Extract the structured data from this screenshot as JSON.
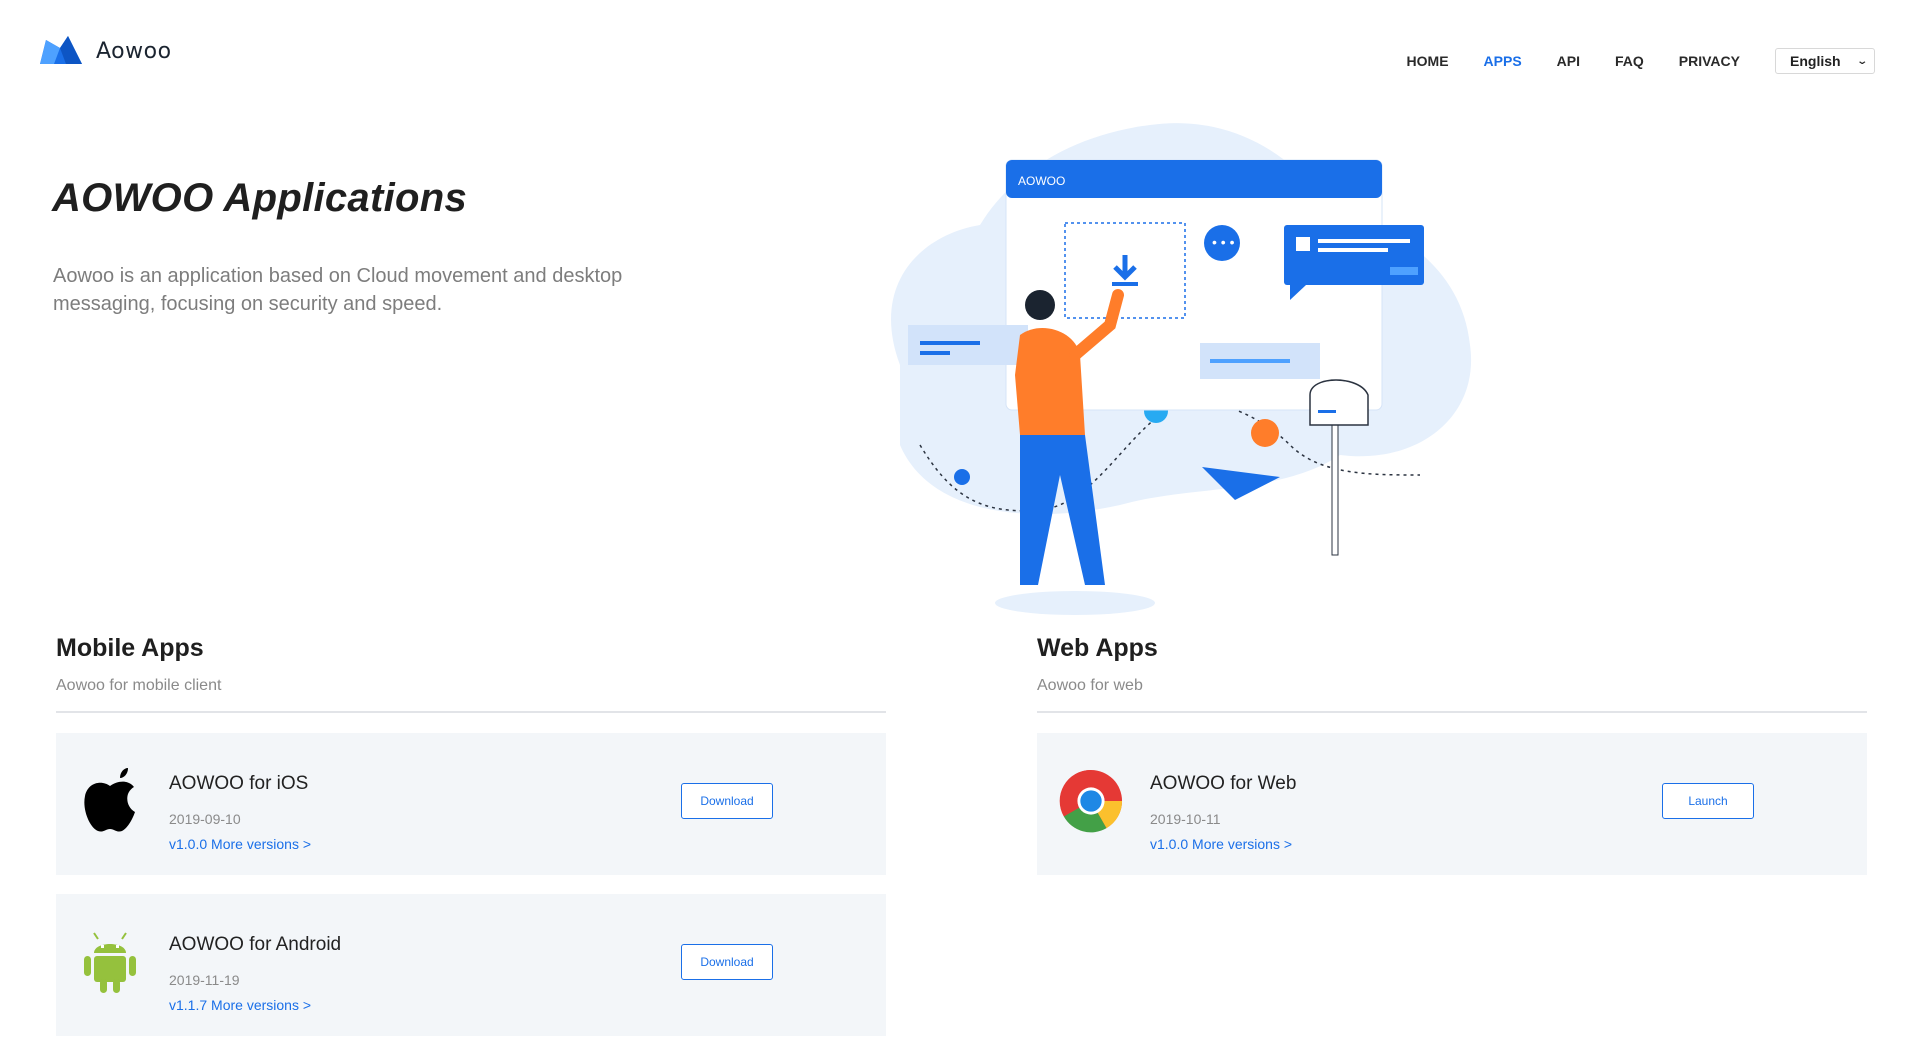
{
  "brand": {
    "name": "Aowoo"
  },
  "nav": {
    "items": [
      {
        "label": "HOME",
        "active": false
      },
      {
        "label": "APPS",
        "active": true
      },
      {
        "label": "API",
        "active": false
      },
      {
        "label": "FAQ",
        "active": false
      },
      {
        "label": "PRIVACY",
        "active": false
      }
    ],
    "language": "English"
  },
  "hero": {
    "title": "AOWOO Applications",
    "description": "Aowoo is an application based on Cloud movement and desktop messaging, focusing on security and speed.",
    "illustration_window_title": "AOWOO"
  },
  "mobile": {
    "title": "Mobile Apps",
    "subtitle": "Aowoo for mobile client",
    "apps": [
      {
        "icon": "apple-icon",
        "name": "AOWOO for iOS",
        "date": "2019-09-10",
        "version": "v1.0.0 More versions >",
        "button": "Download"
      },
      {
        "icon": "android-icon",
        "name": "AOWOO for Android",
        "date": "2019-11-19",
        "version": "v1.1.7 More versions >",
        "button": "Download"
      }
    ]
  },
  "web": {
    "title": "Web Apps",
    "subtitle": "Aowoo for web",
    "apps": [
      {
        "icon": "chrome-icon",
        "name": "AOWOO for Web",
        "date": "2019-10-11",
        "version": "v1.0.0 More versions >",
        "button": "Launch"
      }
    ]
  },
  "colors": {
    "accent": "#1a6fe8",
    "card_bg": "#f3f6f9",
    "illustration_bg": "#e6f0fc",
    "orange": "#ff7d2a"
  }
}
